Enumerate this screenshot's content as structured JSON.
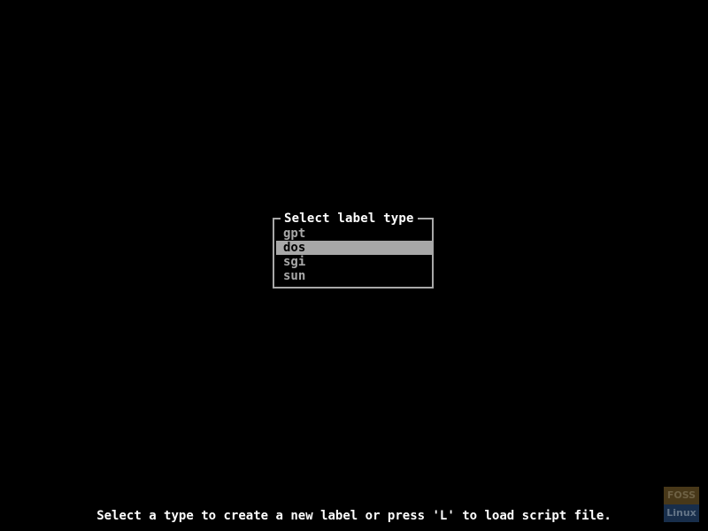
{
  "dialog": {
    "title": "Select label type",
    "options": [
      {
        "label": "gpt",
        "selected": false
      },
      {
        "label": "dos",
        "selected": true
      },
      {
        "label": "sgi",
        "selected": false
      },
      {
        "label": "sun",
        "selected": false
      }
    ]
  },
  "status": {
    "message": "Select a type to create a new label or press 'L' to load script file."
  },
  "watermark": {
    "top": "FOSS",
    "bottom": "Linux"
  },
  "colors": {
    "background": "#000000",
    "foreground": "#a8a8a8",
    "highlight": "#a8a8a8",
    "title": "#ffffff"
  }
}
